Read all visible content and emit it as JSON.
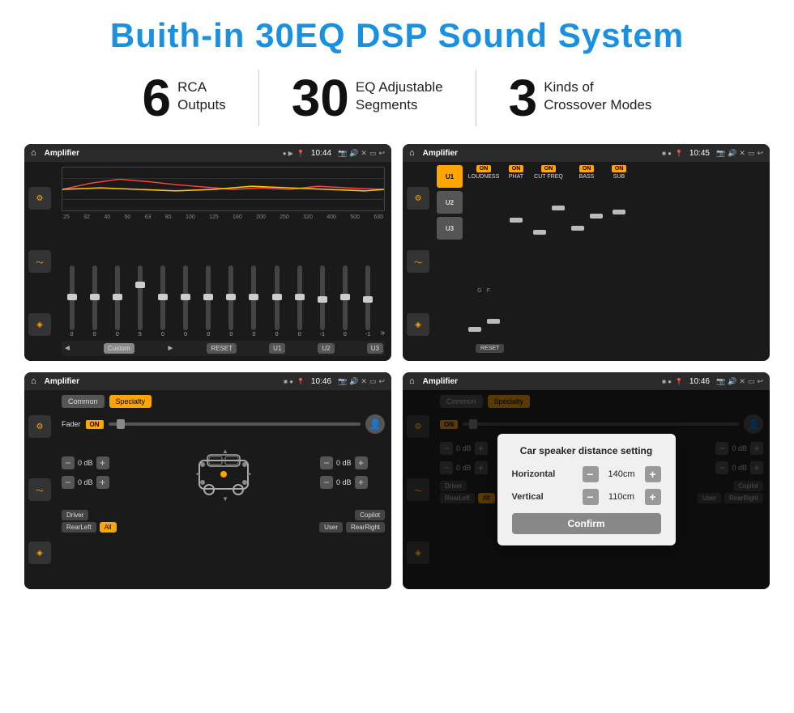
{
  "page": {
    "main_title": "Buith-in 30EQ DSP Sound System",
    "stats": [
      {
        "number": "6",
        "line1": "RCA",
        "line2": "Outputs"
      },
      {
        "number": "30",
        "line1": "EQ Adjustable",
        "line2": "Segments"
      },
      {
        "number": "3",
        "line1": "Kinds of",
        "line2": "Crossover Modes"
      }
    ]
  },
  "screens": {
    "screen1": {
      "title": "Amplifier",
      "time": "10:44",
      "freq_labels": [
        "25",
        "32",
        "40",
        "50",
        "63",
        "80",
        "100",
        "125",
        "160",
        "200",
        "250",
        "320",
        "400",
        "500",
        "630"
      ],
      "bottom_labels": [
        "◄",
        "Custom",
        "►",
        "RESET",
        "U1",
        "U2",
        "U3"
      ],
      "slider_values": [
        "0",
        "0",
        "0",
        "5",
        "0",
        "0",
        "0",
        "0",
        "0",
        "0",
        "0",
        "-1",
        "0",
        "-1"
      ]
    },
    "screen2": {
      "title": "Amplifier",
      "time": "10:45",
      "presets": [
        "U1",
        "U2",
        "U3"
      ],
      "channels": [
        "LOUDNESS",
        "PHAT",
        "CUT FREQ",
        "BASS",
        "SUB"
      ],
      "reset_label": "RESET"
    },
    "screen3": {
      "title": "Amplifier",
      "time": "10:46",
      "tabs": [
        "Common",
        "Specialty"
      ],
      "fader_label": "Fader",
      "on_label": "ON",
      "db_values": [
        "0 dB",
        "0 dB",
        "0 dB",
        "0 dB"
      ],
      "bottom_buttons": [
        "Driver",
        "",
        "",
        "",
        "Copilot",
        "RearLeft",
        "All",
        "",
        "User",
        "RearRight"
      ]
    },
    "screen4": {
      "title": "Amplifier",
      "time": "10:46",
      "tabs": [
        "Common",
        "Specialty"
      ],
      "on_label": "ON",
      "dialog": {
        "title": "Car speaker distance setting",
        "horizontal_label": "Horizontal",
        "horizontal_value": "140cm",
        "vertical_label": "Vertical",
        "vertical_value": "110cm",
        "confirm_label": "Confirm",
        "minus_symbol": "−",
        "plus_symbol": "+"
      },
      "bottom_buttons": [
        "Driver",
        "Copilot",
        "RearLeft",
        "All",
        "User",
        "RearRight"
      ],
      "db_values": [
        "0 dB",
        "0 dB"
      ]
    }
  }
}
